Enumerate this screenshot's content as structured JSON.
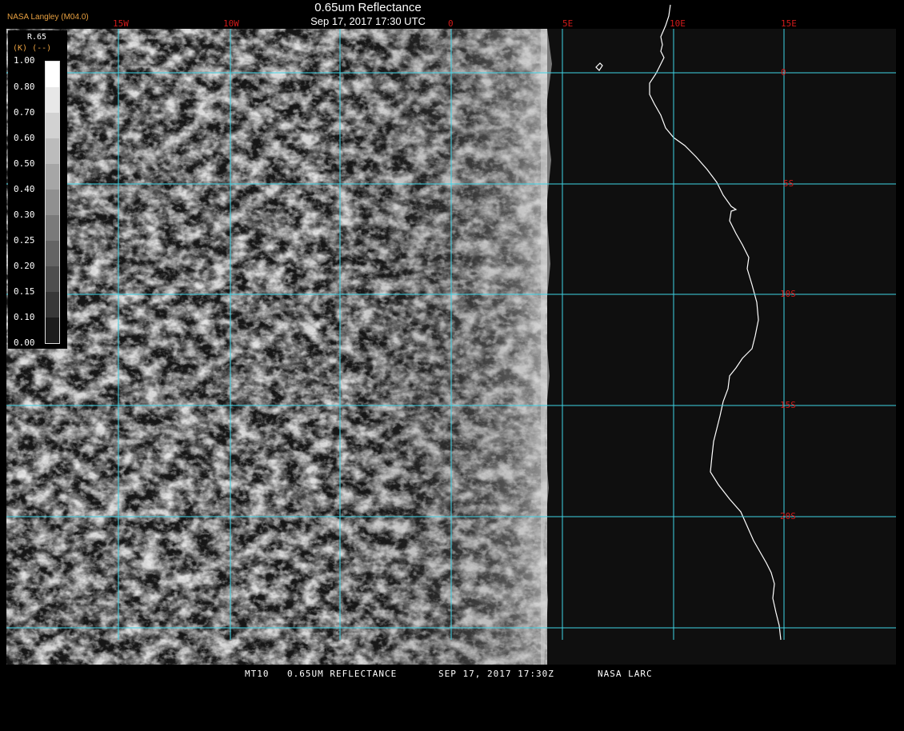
{
  "header": {
    "provider": "NASA Langley (M04.0)",
    "title": "0.65um Reflectance",
    "subtitle": "Sep 17, 2017 17:30 UTC"
  },
  "legend": {
    "title": "R.65",
    "unit": "(K) (--)",
    "ticks": [
      "1.00",
      "0.80",
      "0.70",
      "0.60",
      "0.50",
      "0.40",
      "0.30",
      "0.25",
      "0.20",
      "0.15",
      "0.10",
      "0.00"
    ]
  },
  "grid": {
    "longitudes": [
      "15W",
      "10W",
      "0",
      "5E",
      "10E",
      "15E"
    ],
    "latitudes": [
      "0",
      "5S",
      "10S",
      "15S",
      "20S"
    ]
  },
  "footer": {
    "product": "MT10",
    "field": "0.65UM REFLECTANCE",
    "time": "SEP 17, 2017 17:30Z",
    "source": "NASA LARC"
  },
  "colors": {
    "grid": "#3fd4e6",
    "grid_label": "#d21a1a",
    "provider": "#e8a040",
    "coastline": "#ffffff",
    "background": "#000000"
  }
}
